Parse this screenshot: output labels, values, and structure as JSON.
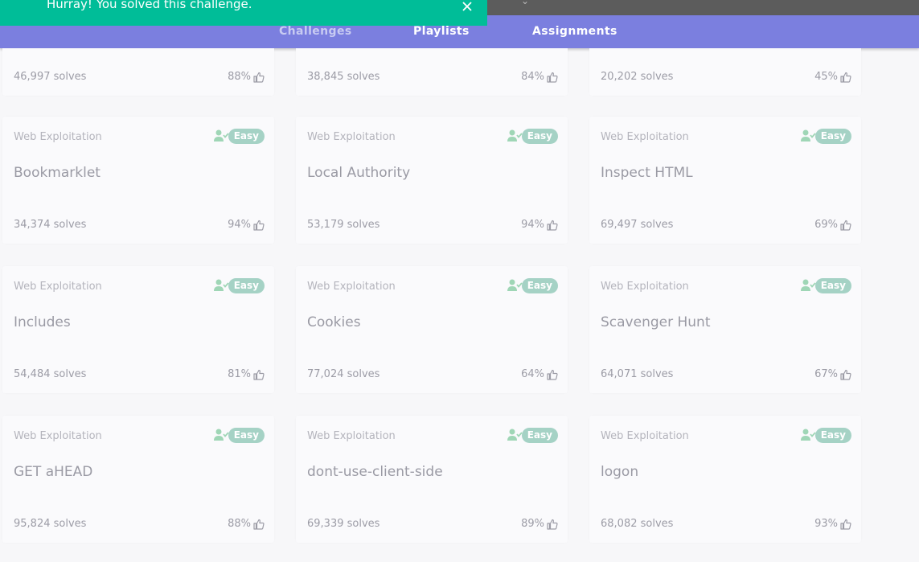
{
  "toast": {
    "message": "Hurray! You solved this challenge."
  },
  "nav": {
    "challenges": "Challenges",
    "playlists": "Playlists",
    "assignments": "Assignments"
  },
  "top_row": [
    {
      "solves": "46,997 solves",
      "rating": "88%"
    },
    {
      "solves": "38,845 solves",
      "rating": "84%"
    },
    {
      "solves": "20,202 solves",
      "rating": "45%"
    }
  ],
  "cards": [
    {
      "category": "Web Exploitation",
      "difficulty": "Easy",
      "title": "Bookmarklet",
      "solves": "34,374 solves",
      "rating": "94%"
    },
    {
      "category": "Web Exploitation",
      "difficulty": "Easy",
      "title": "Local Authority",
      "solves": "53,179 solves",
      "rating": "94%"
    },
    {
      "category": "Web Exploitation",
      "difficulty": "Easy",
      "title": "Inspect HTML",
      "solves": "69,497 solves",
      "rating": "69%"
    },
    {
      "category": "Web Exploitation",
      "difficulty": "Easy",
      "title": "Includes",
      "solves": "54,484 solves",
      "rating": "81%"
    },
    {
      "category": "Web Exploitation",
      "difficulty": "Easy",
      "title": "Cookies",
      "solves": "77,024 solves",
      "rating": "64%"
    },
    {
      "category": "Web Exploitation",
      "difficulty": "Easy",
      "title": "Scavenger Hunt",
      "solves": "64,071 solves",
      "rating": "67%"
    },
    {
      "category": "Web Exploitation",
      "difficulty": "Easy",
      "title": "GET aHEAD",
      "solves": "95,824 solves",
      "rating": "88%"
    },
    {
      "category": "Web Exploitation",
      "difficulty": "Easy",
      "title": "dont-use-client-side",
      "solves": "69,339 solves",
      "rating": "89%"
    },
    {
      "category": "Web Exploitation",
      "difficulty": "Easy",
      "title": "logon",
      "solves": "68,082 solves",
      "rating": "93%"
    }
  ],
  "icons": {
    "solved": "user-check-icon",
    "rating": "thumbs-up-icon",
    "close": "close-icon"
  },
  "colors": {
    "accent": "#7b7fdf",
    "toast": "#00bd98",
    "badge": "#a5d2c5",
    "solved_icon": "#9fd6b6"
  }
}
